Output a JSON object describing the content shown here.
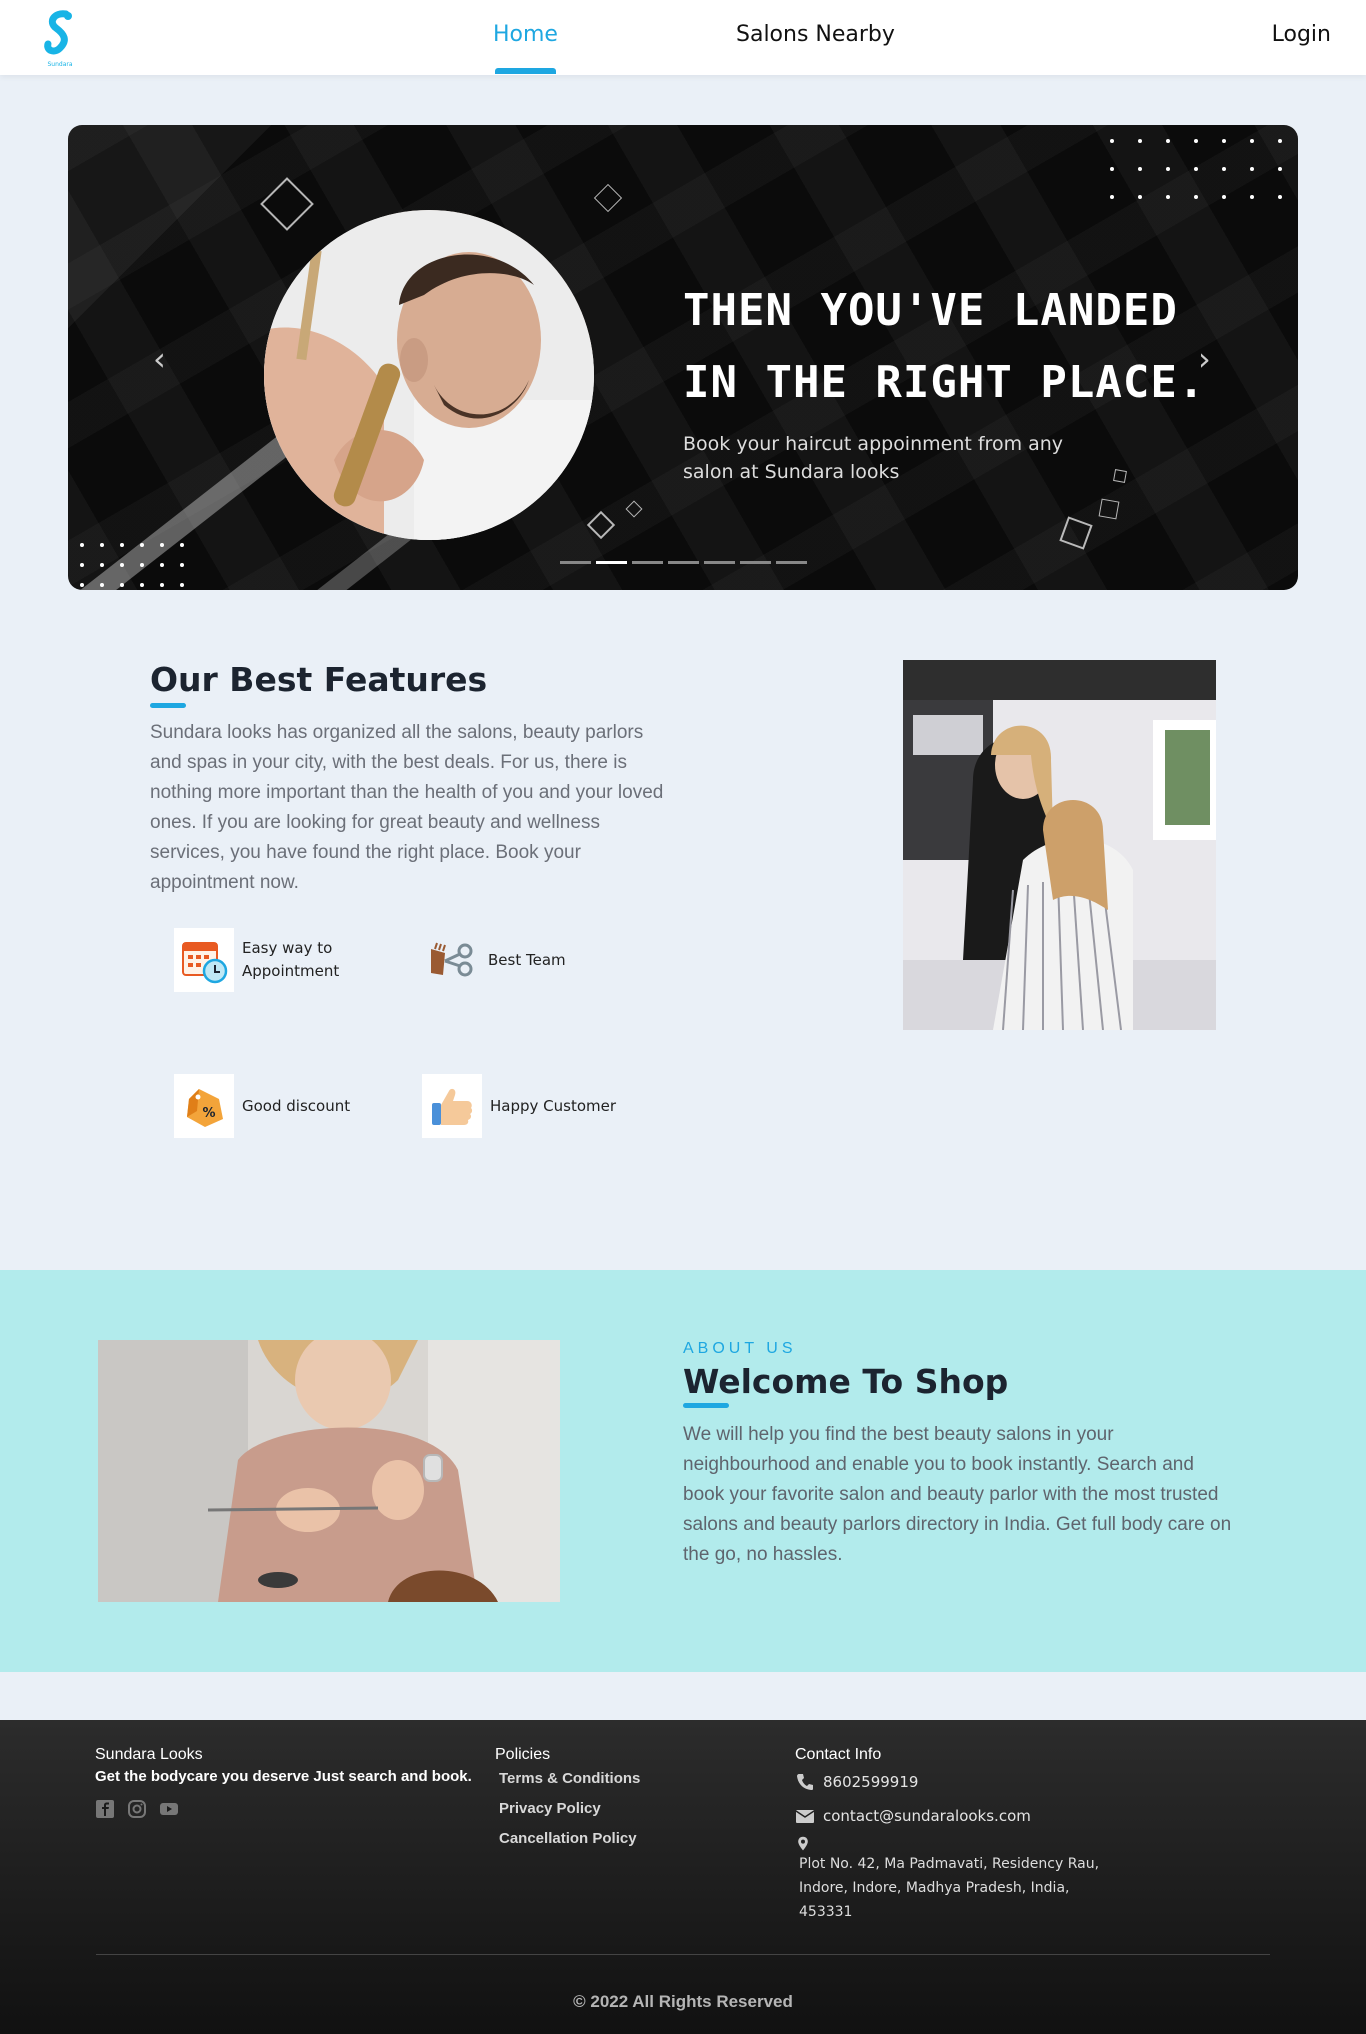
{
  "nav": {
    "home": "Home",
    "salons": "Salons Nearby",
    "login": "Login",
    "logo_text": "Sundara"
  },
  "hero": {
    "headline_1": "THEN YOU'VE LANDED",
    "headline_2": "IN THE RIGHT PLACE.",
    "subtext": "Book your haircut appoinment from any salon at Sundara looks",
    "prev_icon": "chevron-left",
    "next_icon": "chevron-right",
    "slide_count": 7,
    "active_slide": 2
  },
  "features": {
    "title": "Our Best Features",
    "text": "Sundara looks has organized all the salons, beauty parlors and spas in your city, with the best deals. For us, there is nothing more important than the health of you and your loved ones. If you are looking for great beauty and wellness services, you have found the right place. Book your appointment now.",
    "items": [
      {
        "label": "Easy way to Appointment",
        "icon": "calendar-clock-icon"
      },
      {
        "label": "Best Team",
        "icon": "scissors-comb-icon"
      },
      {
        "label": "Good discount",
        "icon": "discount-tag-icon"
      },
      {
        "label": "Happy Customer",
        "icon": "thumbs-up-icon"
      }
    ]
  },
  "about": {
    "kicker": "ABOUT US",
    "title": "Welcome To Shop",
    "text": "We will help you find the best beauty salons in your neighbourhood and enable you to book instantly. Search and book your favorite salon and beauty parlor with the most trusted salons and beauty parlors directory in India. Get full body care on the go, no hassles."
  },
  "footer": {
    "brand": "Sundara Looks",
    "tagline": "Get the bodycare you deserve Just search and book.",
    "social": [
      "facebook-icon",
      "instagram-icon",
      "youtube-icon"
    ],
    "policies_title": "Policies",
    "policies": [
      "Terms & Conditions",
      "Privacy Policy",
      "Cancellation Policy"
    ],
    "contact_title": "Contact Info",
    "phone": "8602599919",
    "email": "contact@sundaralooks.com",
    "address": "Plot No. 42, Ma Padmavati, Residency Rau, Indore, Indore, Madhya Pradesh, India, 453331",
    "copyright": "© 2022 All Rights Reserved"
  },
  "colors": {
    "accent": "#1ea7e1",
    "page_bg": "#eaf0f7",
    "about_bg": "#b2ebec",
    "footer_bg": "#1a1a1a"
  }
}
